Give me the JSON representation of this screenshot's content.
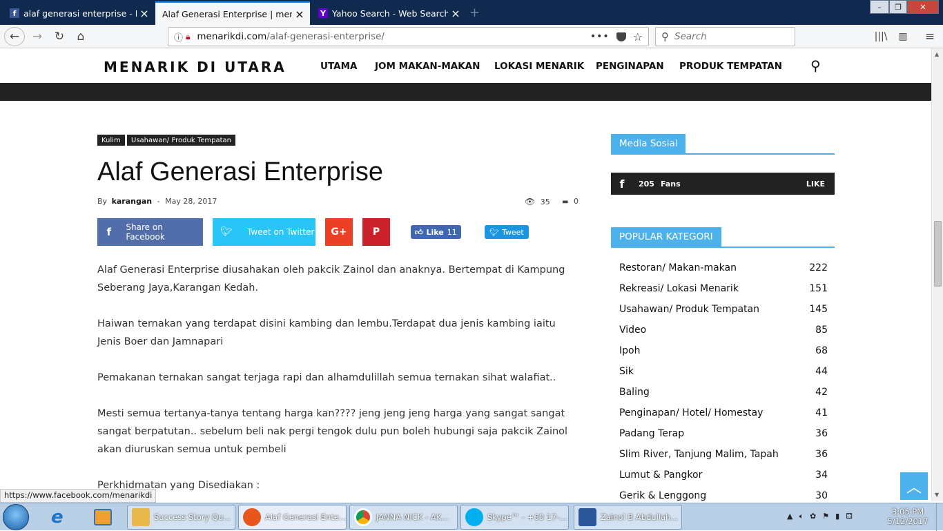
{
  "browser": {
    "tabs": [
      {
        "title": "alaf generasi enterprise - Facebo",
        "favicon": "f",
        "active": false
      },
      {
        "title": "Alaf Generasi Enterprise | menarikdi",
        "favicon": "",
        "active": true
      },
      {
        "title": "Yahoo Search - Web Search",
        "favicon": "Y",
        "active": false
      }
    ],
    "url_domain": "menarikdi.com",
    "url_path": "/alaf-generasi-enterprise/",
    "search_placeholder": "Search",
    "status_url": "https://www.facebook.com/menarikdi"
  },
  "site": {
    "logo": "MENARIK DI UTARA",
    "menu": [
      "UTAMA",
      "JOM MAKAN-MAKAN",
      "LOKASI MENARIK",
      "PENGINAPAN",
      "PRODUK TEMPATAN"
    ]
  },
  "article": {
    "categories": [
      "Kulim",
      "Usahawan/ Produk Tempatan"
    ],
    "title": "Alaf Generasi Enterprise",
    "by": "By",
    "author": "karangan",
    "dash": "-",
    "date": "May 28, 2017",
    "views": "35",
    "comments": "0",
    "share_facebook": "Share on Facebook",
    "share_twitter": "Tweet on Twitter",
    "gplus": "G+",
    "pinterest": "P",
    "like_label": "Like",
    "like_count": "11",
    "tweet_label": "Tweet",
    "paragraphs": [
      [
        "Alaf Generasi Enterprise diusahakan oleh pakcik Zainol dan anaknya. Bertempat di Kampung",
        "Seberang Jaya,Karangan Kedah."
      ],
      [
        "Haiwan ternakan yang terdapat disini kambing dan lembu.Terdapat dua jenis kambing iaitu",
        "Jenis Boer dan Jamnapari"
      ],
      [
        "Pemakanan ternakan sangat terjaga rapi dan alhamdulillah semua ternakan sihat walafiat.."
      ],
      [
        "Mesti semua tertanya-tanya tentang harga kan???? jeng jeng jeng harga yang sangat sangat",
        "sangat berpatutan.. sebelum beli nak pergi tengok dulu pun boleh hubungi saja pakcik Zainol",
        "akan diuruskan semua untuk pembeli"
      ],
      [
        "Perkhidmatan yang Disediakan :"
      ]
    ]
  },
  "sidebar": {
    "media_title": "Media Sosial",
    "fans_count": "205",
    "fans_label": "Fans",
    "like_btn": "LIKE",
    "popular_title": "POPULAR KATEGORI",
    "categories": [
      {
        "name": "Restoran/ Makan-makan",
        "count": "222"
      },
      {
        "name": "Rekreasi/ Lokasi Menarik",
        "count": "151"
      },
      {
        "name": "Usahawan/ Produk Tempatan",
        "count": "145"
      },
      {
        "name": "Video",
        "count": "85"
      },
      {
        "name": "Ipoh",
        "count": "68"
      },
      {
        "name": "Sik",
        "count": "44"
      },
      {
        "name": "Baling",
        "count": "42"
      },
      {
        "name": "Penginapan/ Hotel/ Homestay",
        "count": "41"
      },
      {
        "name": "Padang Terap",
        "count": "36"
      },
      {
        "name": "Slim River, Tanjung Malim, Tapah",
        "count": "36"
      },
      {
        "name": "Lumut & Pangkor",
        "count": "34"
      },
      {
        "name": "Gerik & Lenggong",
        "count": "30"
      }
    ]
  },
  "taskbar": {
    "items": [
      {
        "label": "Success Story Qu...",
        "icon_color": "#e8b84a"
      },
      {
        "label": "Alaf Generasi Ente...",
        "icon_color": "#e8561e"
      },
      {
        "label": "JANNA NICK - AK...",
        "icon_color": "#3b8ad9"
      },
      {
        "label": "Skype™ - +60 17-...",
        "icon_color": "#00aff0"
      },
      {
        "label": "Zainol B Abdullah...",
        "icon_color": "#2b579a"
      }
    ],
    "time": "3:05 PM",
    "date": "5/12/2017"
  }
}
